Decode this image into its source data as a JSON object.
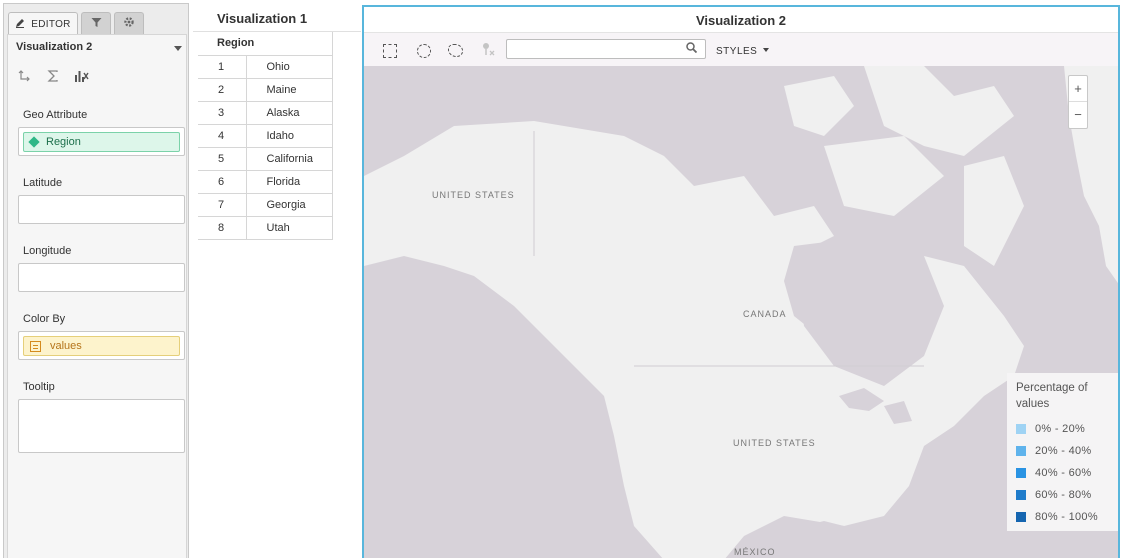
{
  "editor": {
    "tabs": {
      "editor": "EDITOR"
    },
    "visualization_select": "Visualization 2",
    "fields": {
      "geo_attribute": {
        "label": "Geo Attribute",
        "value": "Region"
      },
      "latitude": {
        "label": "Latitude"
      },
      "longitude": {
        "label": "Longitude"
      },
      "color_by": {
        "label": "Color By",
        "value": "values"
      },
      "tooltip": {
        "label": "Tooltip"
      }
    },
    "icons": [
      "swap-icon",
      "sigma-icon",
      "chart-settings-icon"
    ]
  },
  "viz1": {
    "title": "Visualization 1",
    "column_header": "Region",
    "rows": [
      {
        "num": "1",
        "name": "Ohio"
      },
      {
        "num": "2",
        "name": "Maine"
      },
      {
        "num": "3",
        "name": "Alaska"
      },
      {
        "num": "4",
        "name": "Idaho"
      },
      {
        "num": "5",
        "name": "California"
      },
      {
        "num": "6",
        "name": "Florida"
      },
      {
        "num": "7",
        "name": "Georgia"
      },
      {
        "num": "8",
        "name": "Utah"
      }
    ]
  },
  "viz2": {
    "title": "Visualization 2",
    "search_placeholder": "",
    "styles_label": "STYLES",
    "zoom_in": "+",
    "zoom_out": "−",
    "map_labels": {
      "alaska": "UNITED STATES",
      "canada": "CANADA",
      "usa": "UNITED STATES",
      "mexico": "MÉXICO"
    },
    "legend": {
      "title": "Percentage of values",
      "items": [
        {
          "label": "0% - 20%",
          "color": "#9fd3f4"
        },
        {
          "label": "20% - 40%",
          "color": "#5fb3ec"
        },
        {
          "label": "40% - 60%",
          "color": "#2a93e3"
        },
        {
          "label": "60% - 80%",
          "color": "#1f7ccb"
        },
        {
          "label": "80% - 100%",
          "color": "#1565b0"
        }
      ]
    }
  },
  "colors": {
    "map_water": "#d7d2d9",
    "map_land": "#f0f0f0",
    "active_border": "#58b6dc"
  }
}
